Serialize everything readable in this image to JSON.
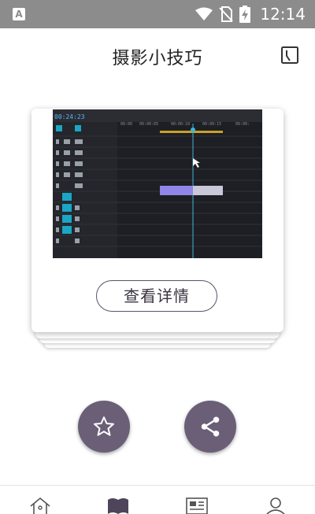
{
  "status_bar": {
    "app_icon_letter": "A",
    "time": "12:14",
    "icons": [
      "wifi-icon",
      "no-sim-icon",
      "battery-charging-icon"
    ]
  },
  "header": {
    "title": "摄影小技巧",
    "action_icon": "bookmark-square-icon"
  },
  "card": {
    "image": "video-editor-timeline-screenshot",
    "detail_button_label": "查看详情"
  },
  "actions": {
    "favorite_icon": "star-icon",
    "share_icon": "share-icon"
  },
  "bottom_nav": {
    "items": [
      {
        "icon": "home-icon",
        "active": false
      },
      {
        "icon": "book-icon",
        "active": true
      },
      {
        "icon": "article-icon",
        "active": false
      },
      {
        "icon": "profile-icon",
        "active": false
      }
    ]
  },
  "colors": {
    "status_bar": "#8c8c8c",
    "accent": "#6a5f77",
    "button_border": "#5b5266",
    "timeline_bg": "#1e1f24",
    "timeline_highlight": "#1aa6c4"
  }
}
